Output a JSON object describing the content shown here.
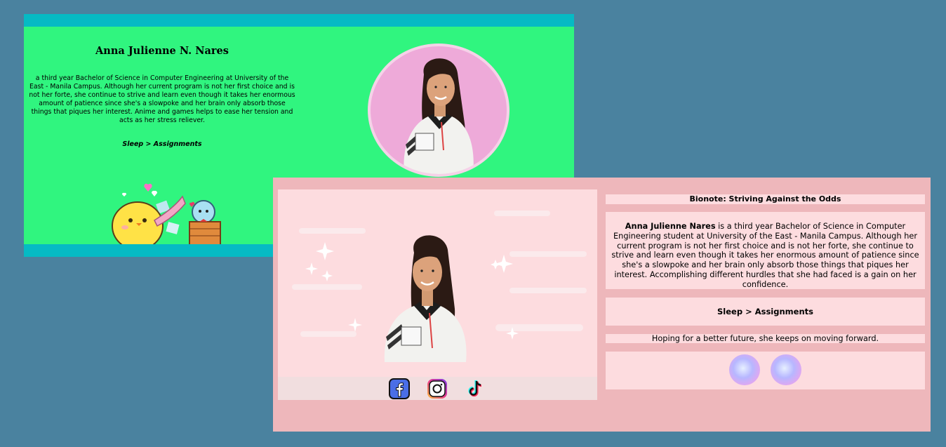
{
  "profile_card": {
    "name": "Anna Julienne N. Nares",
    "description": "a third year Bachelor of Science in Computer Engineering at University of the East - Manila Campus. Although her current program is not her first choice and is not her forte, she continue to strive and learn even though it takes her enormous amount of patience since she's a slowpoke and her brain only absorb those things that piques her interest. Anime and games helps to ease her tension and acts as her stress reliever.",
    "quote": "Sleep > Assignments"
  },
  "bionote_card": {
    "title": "Bionote: Striving Against the Odds",
    "bio_name": "Anna Julienne Nares",
    "bio_rest": " is a third year Bachelor of Science in Computer Engineering student at University of the East - Manila Campus. Although her current program is not her first choice and is not her forte, she continue to strive and learn even though it takes her enormous amount of patience since she's a slowpoke and her brain only absorb those things that piques her interest. Accomplishing different hurdles that she had faced is a gain on her confidence.",
    "quote": "Sleep > Assignments",
    "tagline": "Hoping for a better future, she keeps on moving forward.",
    "social_icons": [
      "facebook-icon",
      "instagram-icon",
      "tiktok-icon"
    ]
  },
  "colors": {
    "desktop_bg": "#4a829f",
    "green_bg": "#30f57f",
    "teal_bar": "#06bac4",
    "pink_bg": "#eeb7bb",
    "pink_panel": "#fddcdf"
  }
}
